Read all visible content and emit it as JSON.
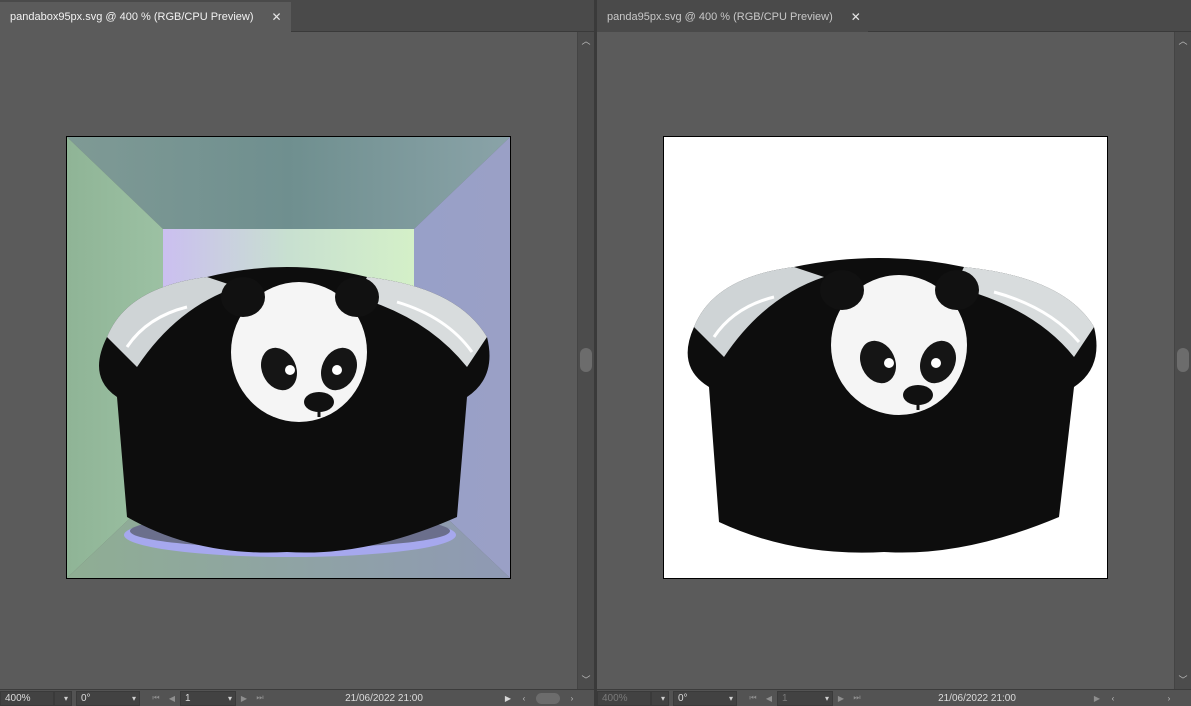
{
  "documents": [
    {
      "tab_title": "pandabox95px.svg @ 400 % (RGB/CPU Preview)",
      "zoom": "400%",
      "rotation": "0°",
      "page": "1",
      "date": "21/06/2022  21:00"
    },
    {
      "tab_title": "panda95px.svg @ 400 % (RGB/CPU Preview)",
      "zoom": "400%",
      "rotation": "0°",
      "page": "1",
      "date": "21/06/2022  21:00"
    }
  ],
  "icons": {
    "close": "close-icon",
    "dropdown": "chevron-down-icon",
    "scroll_up": "chevron-up-icon",
    "scroll_down": "chevron-down-icon",
    "first_page": "first-page-icon",
    "prev_page": "prev-page-icon",
    "next_page": "next-page-icon",
    "last_page": "last-page-icon",
    "play": "play-icon"
  },
  "colors": {
    "panel_bg": "#5b5b5b",
    "tab_active": "#5b5b5b",
    "tab_inactive": "#4a4a4a",
    "statusbar": "#535353",
    "artboard_white": "#ffffff"
  }
}
